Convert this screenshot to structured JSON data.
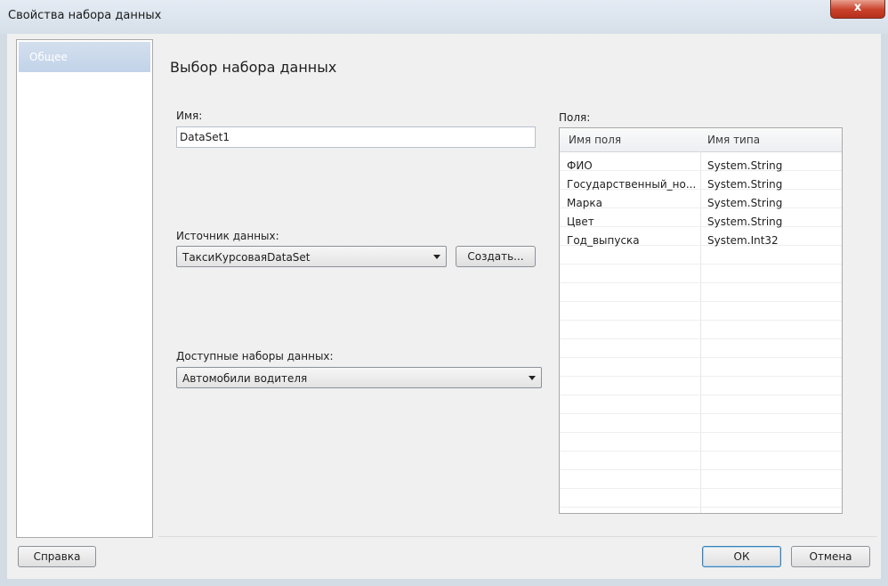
{
  "window": {
    "title": "Свойства набора данных",
    "close_label": "x"
  },
  "nav": {
    "items": [
      {
        "label": "Общее"
      }
    ]
  },
  "main": {
    "heading": "Выбор набора данных",
    "name": {
      "label": "Имя:",
      "value": "DataSet1"
    },
    "source": {
      "label": "Источник данных:",
      "value": "ТаксиКурсоваяDataSet",
      "create_label": "Создать..."
    },
    "available": {
      "label": "Доступные наборы данных:",
      "value": "Автомобили водителя"
    }
  },
  "fields": {
    "label": "Поля:",
    "columns": [
      "Имя поля",
      "Имя типа"
    ],
    "rows": [
      [
        "ФИО",
        "System.String"
      ],
      [
        "Государственный_но...",
        "System.String"
      ],
      [
        "Марка",
        "System.String"
      ],
      [
        "Цвет",
        "System.String"
      ],
      [
        "Год_выпуска",
        "System.Int32"
      ]
    ]
  },
  "footer": {
    "help_label": "Справка",
    "ok_label": "ОК",
    "cancel_label": "Отмена"
  }
}
